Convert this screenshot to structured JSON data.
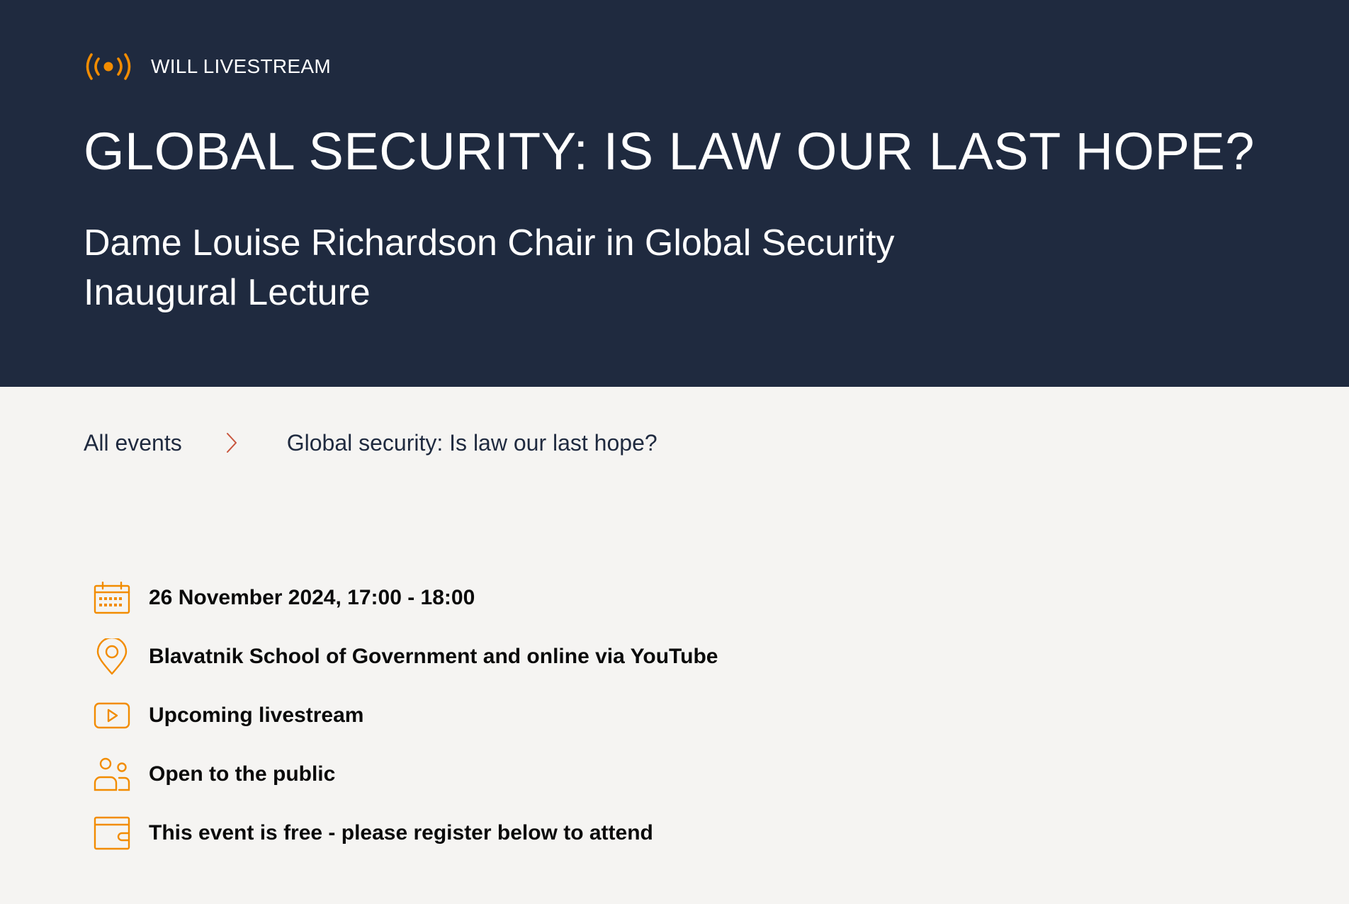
{
  "colors": {
    "hero_background": "#1f2a3f",
    "accent_orange": "#f28c00",
    "breadcrumb_chevron": "#c8553d",
    "page_background": "#f5f4f2"
  },
  "hero": {
    "badge": {
      "icon": "livestream-broadcast-icon",
      "label": "WILL LIVESTREAM"
    },
    "title": "GLOBAL SECURITY: IS LAW OUR LAST HOPE?",
    "subtitle_line1": "Dame Louise Richardson Chair in Global Security",
    "subtitle_line2": "Inaugural Lecture"
  },
  "breadcrumb": {
    "items": [
      {
        "label": "All events"
      },
      {
        "label": "Global security: Is law our last hope?"
      }
    ],
    "separator_icon": "chevron-right-icon"
  },
  "details": [
    {
      "icon": "calendar-icon",
      "text": "26 November 2024, 17:00 - 18:00"
    },
    {
      "icon": "location-pin-icon",
      "text": "Blavatnik School of Government and online via YouTube"
    },
    {
      "icon": "video-play-icon",
      "text": "Upcoming livestream"
    },
    {
      "icon": "people-icon",
      "text": "Open to the public"
    },
    {
      "icon": "wallet-icon",
      "text": "This event is free - please register below to attend"
    }
  ]
}
